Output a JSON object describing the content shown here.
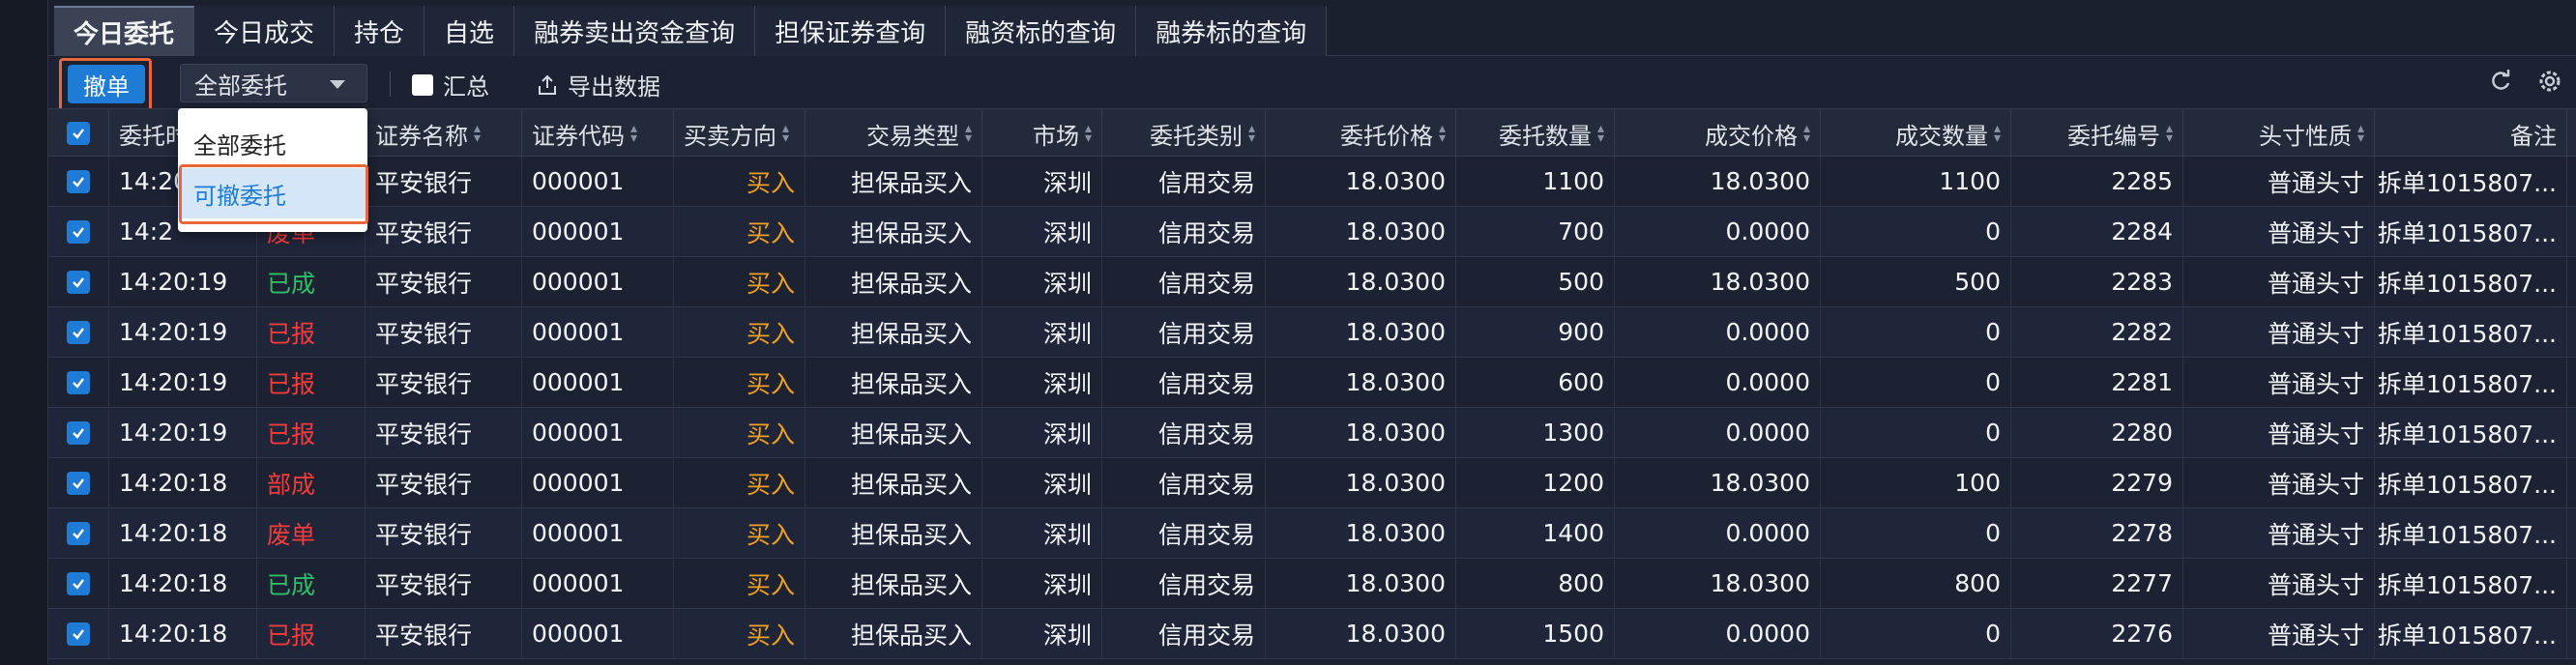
{
  "tabs": [
    "今日委托",
    "今日成交",
    "持仓",
    "自选",
    "融券卖出资金查询",
    "担保证券查询",
    "融资标的查询",
    "融券标的查询"
  ],
  "toolbar": {
    "cancel_label": "撤单",
    "filter_value": "全部委托",
    "summary_label": "汇总",
    "export_label": "导出数据"
  },
  "dropdown": {
    "options": [
      "全部委托",
      "可撤委托"
    ],
    "selected": "可撤委托"
  },
  "columns": [
    "委托时间",
    "",
    "证券名称",
    "证券代码",
    "买卖方向",
    "交易类型",
    "市场",
    "委托类别",
    "委托价格",
    "委托数量",
    "成交价格",
    "成交数量",
    "委托编号",
    "头寸性质",
    "备注"
  ],
  "header_visible": [
    "委托时",
    "证券名称",
    "证券代码",
    "买卖方向",
    "交易类型",
    "市场",
    "委托类别",
    "委托价格",
    "委托数量",
    "成交价格",
    "成交数量",
    "委托编号",
    "头寸性质",
    "备注"
  ],
  "rows": [
    {
      "time": "14:20",
      "status": "",
      "name": "平安银行",
      "code": "000001",
      "side": "买入",
      "type": "担保品买入",
      "market": "深圳",
      "cat": "信用交易",
      "price": "18.0300",
      "qty": "1100",
      "fill_price": "18.0300",
      "fill_qty": "1100",
      "id": "2285",
      "pos": "普通头寸",
      "note": "拆单1015807..."
    },
    {
      "time": "14:2",
      "status": "废单",
      "name": "平安银行",
      "code": "000001",
      "side": "买入",
      "type": "担保品买入",
      "market": "深圳",
      "cat": "信用交易",
      "price": "18.0300",
      "qty": "700",
      "fill_price": "0.0000",
      "fill_qty": "0",
      "id": "2284",
      "pos": "普通头寸",
      "note": "拆单1015807..."
    },
    {
      "time": "14:20:19",
      "status": "已成",
      "name": "平安银行",
      "code": "000001",
      "side": "买入",
      "type": "担保品买入",
      "market": "深圳",
      "cat": "信用交易",
      "price": "18.0300",
      "qty": "500",
      "fill_price": "18.0300",
      "fill_qty": "500",
      "id": "2283",
      "pos": "普通头寸",
      "note": "拆单1015807..."
    },
    {
      "time": "14:20:19",
      "status": "已报",
      "name": "平安银行",
      "code": "000001",
      "side": "买入",
      "type": "担保品买入",
      "market": "深圳",
      "cat": "信用交易",
      "price": "18.0300",
      "qty": "900",
      "fill_price": "0.0000",
      "fill_qty": "0",
      "id": "2282",
      "pos": "普通头寸",
      "note": "拆单1015807..."
    },
    {
      "time": "14:20:19",
      "status": "已报",
      "name": "平安银行",
      "code": "000001",
      "side": "买入",
      "type": "担保品买入",
      "market": "深圳",
      "cat": "信用交易",
      "price": "18.0300",
      "qty": "600",
      "fill_price": "0.0000",
      "fill_qty": "0",
      "id": "2281",
      "pos": "普通头寸",
      "note": "拆单1015807..."
    },
    {
      "time": "14:20:19",
      "status": "已报",
      "name": "平安银行",
      "code": "000001",
      "side": "买入",
      "type": "担保品买入",
      "market": "深圳",
      "cat": "信用交易",
      "price": "18.0300",
      "qty": "1300",
      "fill_price": "0.0000",
      "fill_qty": "0",
      "id": "2280",
      "pos": "普通头寸",
      "note": "拆单1015807..."
    },
    {
      "time": "14:20:18",
      "status": "部成",
      "name": "平安银行",
      "code": "000001",
      "side": "买入",
      "type": "担保品买入",
      "market": "深圳",
      "cat": "信用交易",
      "price": "18.0300",
      "qty": "1200",
      "fill_price": "18.0300",
      "fill_qty": "100",
      "id": "2279",
      "pos": "普通头寸",
      "note": "拆单1015807..."
    },
    {
      "time": "14:20:18",
      "status": "废单",
      "name": "平安银行",
      "code": "000001",
      "side": "买入",
      "type": "担保品买入",
      "market": "深圳",
      "cat": "信用交易",
      "price": "18.0300",
      "qty": "1400",
      "fill_price": "0.0000",
      "fill_qty": "0",
      "id": "2278",
      "pos": "普通头寸",
      "note": "拆单1015807..."
    },
    {
      "time": "14:20:18",
      "status": "已成",
      "name": "平安银行",
      "code": "000001",
      "side": "买入",
      "type": "担保品买入",
      "market": "深圳",
      "cat": "信用交易",
      "price": "18.0300",
      "qty": "800",
      "fill_price": "18.0300",
      "fill_qty": "800",
      "id": "2277",
      "pos": "普通头寸",
      "note": "拆单1015807..."
    },
    {
      "time": "14:20:18",
      "status": "已报",
      "name": "平安银行",
      "code": "000001",
      "side": "买入",
      "type": "担保品买入",
      "market": "深圳",
      "cat": "信用交易",
      "price": "18.0300",
      "qty": "1500",
      "fill_price": "0.0000",
      "fill_qty": "0",
      "id": "2276",
      "pos": "普通头寸",
      "note": "拆单1015807..."
    }
  ],
  "colors": {
    "accent": "#1e7cd6",
    "highlight": "#e8663a",
    "buy": "#f0a020",
    "status_red": "#f23b3b",
    "status_green": "#2dbf68"
  },
  "icons": [
    "refresh-icon",
    "gear-icon",
    "export-icon",
    "check-icon",
    "caret-down-icon"
  ]
}
